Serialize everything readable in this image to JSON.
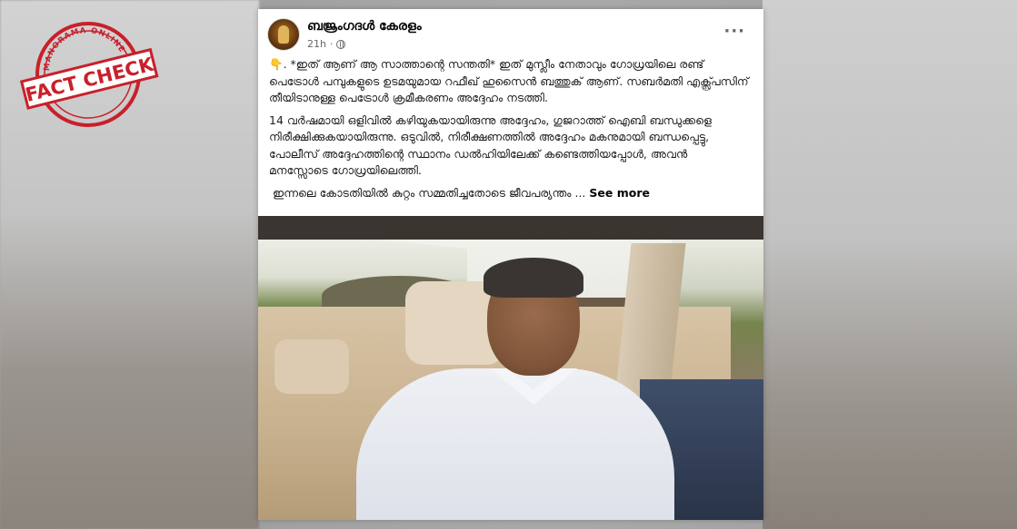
{
  "watermark": {
    "top_text": "MANORAMA ONLINE",
    "main_text": "FACT CHECK",
    "color": "#c8202a"
  },
  "post": {
    "page_name": "ബജ്രംഗദൾ കേരളം",
    "time": "21h",
    "privacy_icon": "globe-icon",
    "more_icon": "more-options-icon",
    "paragraphs": [
      "*ഇത് ആണ് ആ സാത്താന്റെ സന്തതി*  ഇത് മുസ്ലീം നേതാവും ഗോധ്രയിലെ രണ്ട് പെട്രോൾ പമ്പുകളുടെ ഉടമയുമായ റഫീഖ് ഹുസൈൻ ബത്തുക് ആണ്. സബർമതി എക്സ്പ്രസിന് തീയിടാനുള്ള പെട്രോൾ ക്രമീകരണം അദ്ദേഹം നടത്തി.",
      " 14 വർഷമായി ഒളിവിൽ കഴിയുകയായിരുന്നു അദ്ദേഹം, ഗുജറാത്ത് ഐബി ബന്ധുക്കളെ നിരീക്ഷിക്കുകയായിരുന്നു.  ഒടുവിൽ, നിരീക്ഷണത്തിൽ അദ്ദേഹം മകനുമായി ബന്ധപ്പെട്ടു, പോലീസ് അദ്ദേഹത്തിന്റെ സ്ഥാനം ഡൽഹിയിലേക്ക് കണ്ടെത്തിയപ്പോൾ, അവൻ മനസ്സോടെ ഗോധ്രയിലെത്തി."
    ],
    "last_line": "ഇന്നലെ കോടതിയിൽ കുറ്റം സമ്മതിച്ചതോടെ ജീവപര്യന്തം ...",
    "see_more": "See more",
    "pointer_emoji": "👇",
    "photo_subject": "man-in-car-photo"
  }
}
